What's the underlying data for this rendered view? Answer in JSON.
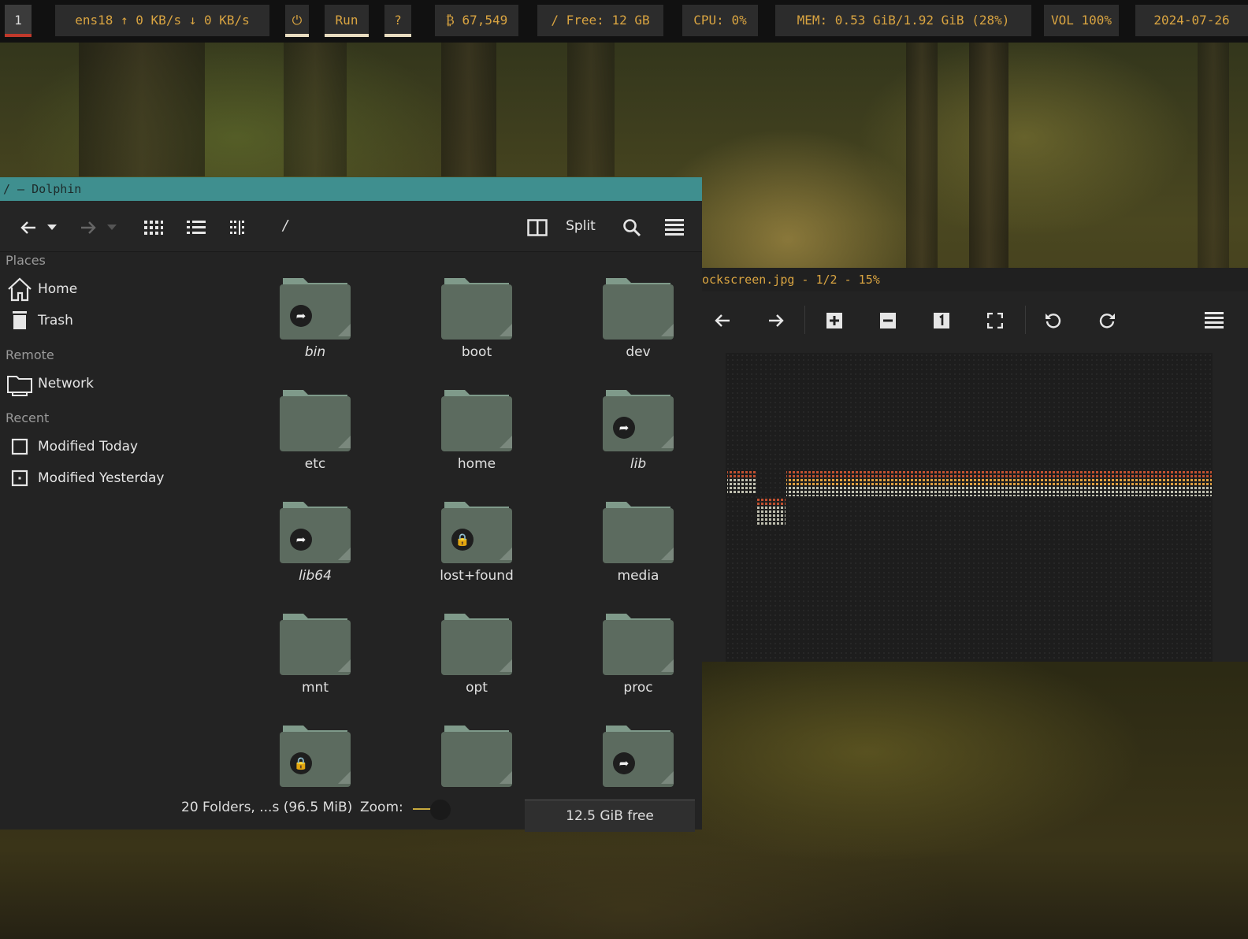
{
  "topbar": {
    "workspace": "1",
    "network": "ens18 ↑ 0 KB/s ↓ 0 KB/s",
    "power_icon": "power-icon",
    "run": "Run",
    "help": "?",
    "btc": "₿ 67,549",
    "disk": "/ Free: 12 GB",
    "cpu": "CPU: 0%",
    "mem": "MEM: 0.53 GiB/1.92 GiB (28%)",
    "vol": "VOL 100%",
    "date": "2024-07-26",
    "colors": {
      "accent": "#d9a441",
      "workspace_underline": "#c0392b",
      "bar_bg": "#111111"
    }
  },
  "dolphin": {
    "title": "/ — Dolphin",
    "toolbar": {
      "back_icon": "arrow-left-icon",
      "forward_icon": "arrow-right-icon",
      "location": "/",
      "split_label": "Split",
      "search_icon": "search-icon",
      "menu_icon": "hamburger-icon"
    },
    "places": {
      "places_title": "Places",
      "home": "Home",
      "trash": "Trash",
      "remote_title": "Remote",
      "network": "Network",
      "recent_title": "Recent",
      "modified_today": "Modified Today",
      "modified_yesterday": "Modified Yesterday"
    },
    "folders": [
      {
        "name": "bin",
        "italic": true,
        "badge": "link"
      },
      {
        "name": "boot",
        "italic": false,
        "badge": ""
      },
      {
        "name": "dev",
        "italic": false,
        "badge": ""
      },
      {
        "name": "etc",
        "italic": false,
        "badge": ""
      },
      {
        "name": "home",
        "italic": false,
        "badge": ""
      },
      {
        "name": "lib",
        "italic": true,
        "badge": "link"
      },
      {
        "name": "lib64",
        "italic": true,
        "badge": "link"
      },
      {
        "name": "lost+found",
        "italic": false,
        "badge": "lock"
      },
      {
        "name": "media",
        "italic": false,
        "badge": ""
      },
      {
        "name": "mnt",
        "italic": false,
        "badge": ""
      },
      {
        "name": "opt",
        "italic": false,
        "badge": ""
      },
      {
        "name": "proc",
        "italic": false,
        "badge": ""
      },
      {
        "name": "",
        "italic": false,
        "badge": "lock"
      },
      {
        "name": "",
        "italic": false,
        "badge": ""
      },
      {
        "name": "",
        "italic": false,
        "badge": "link"
      }
    ],
    "status": {
      "summary": "20 Folders, ...s (96.5 MiB)",
      "zoom_label": "Zoom:",
      "free": "12.5 GiB free"
    },
    "colors": {
      "titlebar": "#3f8f8f",
      "folder": "#5c6b5f",
      "folder_tab": "#7f9a8a"
    }
  },
  "viewer": {
    "title": "ockscreen.jpg - 1/2 - 15%",
    "toolbar": {
      "prev_icon": "arrow-left-icon",
      "next_icon": "arrow-right-icon",
      "zoom_in_icon": "zoom-in-icon",
      "zoom_out_icon": "zoom-out-icon",
      "actual_size_icon": "actual-size-icon",
      "fullscreen_icon": "fullscreen-icon",
      "rotate_left_icon": "rotate-left-icon",
      "rotate_right_icon": "rotate-right-icon",
      "menu_icon": "hamburger-icon"
    }
  }
}
